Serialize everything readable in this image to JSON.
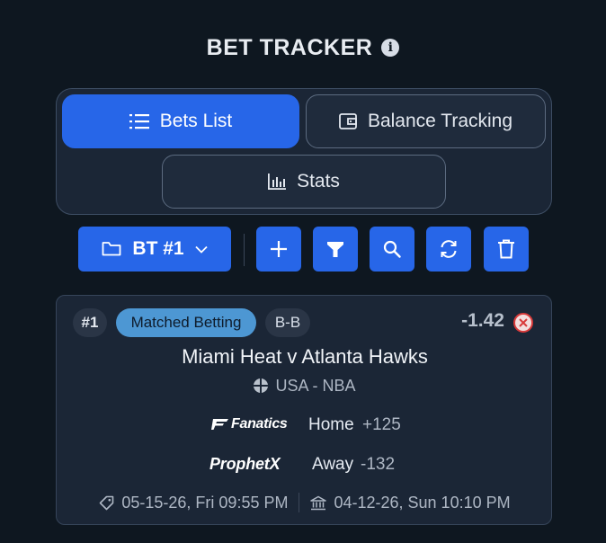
{
  "header": {
    "title": "BET TRACKER",
    "info_icon": "info-icon"
  },
  "tabs": [
    {
      "label": "Bets List",
      "icon": "list-icon",
      "active": true
    },
    {
      "label": "Balance Tracking",
      "icon": "wallet-icon",
      "active": false
    },
    {
      "label": "Stats",
      "icon": "bar-chart-icon",
      "active": false
    }
  ],
  "toolbar": {
    "tracker_label": "BT #1",
    "tracker_icon": "folder-icon",
    "buttons": [
      "add-icon",
      "filter-icon",
      "search-icon",
      "refresh-icon",
      "trash-icon"
    ]
  },
  "bet": {
    "number": "#1",
    "type": "Matched Betting",
    "mode": "B-B",
    "profit": "-1.42",
    "event": "Miami Heat v Atlanta Hawks",
    "league": "USA - NBA",
    "legs": [
      {
        "book": "Fanatics",
        "selection": "Home",
        "odds": "+125"
      },
      {
        "book": "ProphetX",
        "selection": "Away",
        "odds": "-132"
      }
    ],
    "placed_date": "05-15-26, Fri 09:55 PM",
    "event_date": "04-12-26, Sun 10:10 PM"
  },
  "colors": {
    "background": "#0e1720",
    "panel": "#1b2636",
    "accent": "#2766e8",
    "badge_type": "#4d97d3",
    "danger": "#d93a3a"
  }
}
